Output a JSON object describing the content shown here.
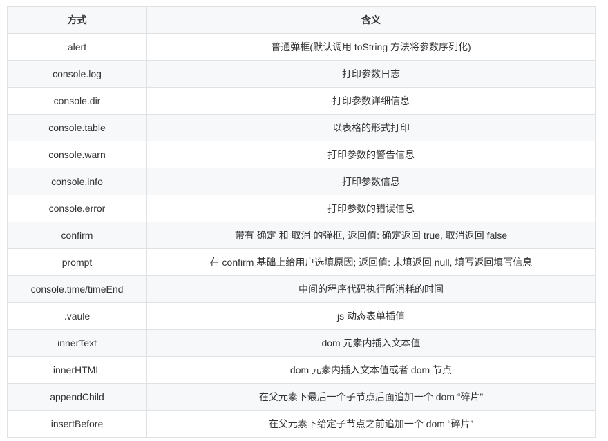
{
  "table": {
    "headers": [
      "方式",
      "含义"
    ],
    "rows": [
      [
        "alert",
        "普通弹框(默认调用 toString 方法将参数序列化)"
      ],
      [
        "console.log",
        "打印参数日志"
      ],
      [
        "console.dir",
        "打印参数详细信息"
      ],
      [
        "console.table",
        "以表格的形式打印"
      ],
      [
        "console.warn",
        "打印参数的警告信息"
      ],
      [
        "console.info",
        "打印参数信息"
      ],
      [
        "console.error",
        "打印参数的错误信息"
      ],
      [
        "confirm",
        "带有 确定 和 取消 的弹框, 返回值: 确定返回 true, 取消返回 false"
      ],
      [
        "prompt",
        "在 confirm 基础上给用户选填原因; 返回值: 未填返回 null, 填写返回填写信息"
      ],
      [
        "console.time/timeEnd",
        "中间的程序代码执行所消耗的时间"
      ],
      [
        ".vaule",
        "js 动态表单插值"
      ],
      [
        "innerText",
        "dom 元素内插入文本值"
      ],
      [
        "innerHTML",
        "dom 元素内插入文本值或者 dom 节点"
      ],
      [
        "appendChild",
        "在父元素下最后一个子节点后面追加一个 dom “碎片”"
      ],
      [
        "insertBefore",
        "在父元素下给定子节点之前追加一个 dom “碎片”"
      ]
    ]
  }
}
